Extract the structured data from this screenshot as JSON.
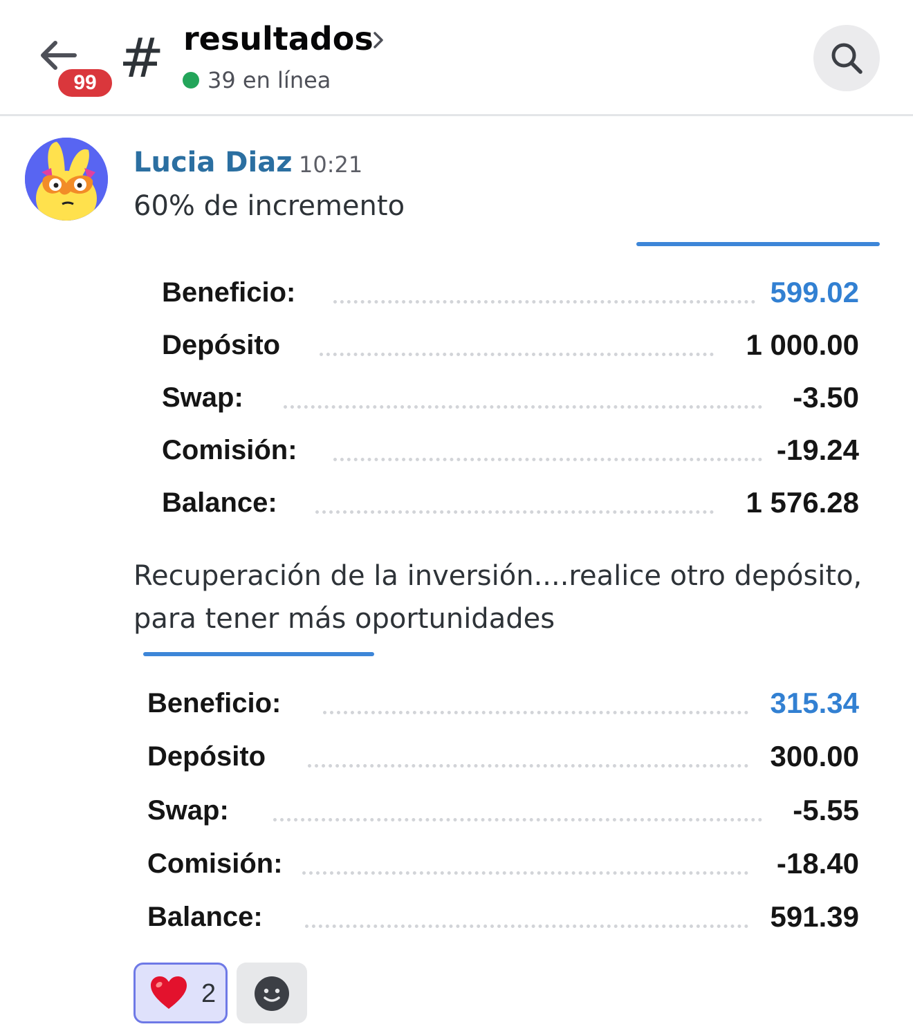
{
  "header": {
    "back_badge": "99",
    "channel_hash": "#",
    "channel_name": "resultados",
    "online_text": "39 en línea",
    "icons": {
      "back": "arrow-left-icon",
      "chevron": "chevron-right-icon",
      "search": "search-icon"
    }
  },
  "message": {
    "author": "Lucia Diaz",
    "time": "10:21",
    "text1": "60% de incremento",
    "text2": "Recuperación de la inversión....realice otro depósito, para tener más oportunidades",
    "author_color": "#2b6fa1"
  },
  "card1": {
    "rows": [
      {
        "label": "Beneficio:",
        "value": "599.02"
      },
      {
        "label": "Depósito",
        "value": "1 000.00"
      },
      {
        "label": "Swap:",
        "value": "-3.50"
      },
      {
        "label": "Comisión:",
        "value": "-19.24"
      },
      {
        "label": "Balance:",
        "value": "1 576.28"
      }
    ]
  },
  "card2": {
    "rows": [
      {
        "label": "Beneficio:",
        "value": "315.34"
      },
      {
        "label": "Depósito",
        "value": "300.00"
      },
      {
        "label": "Swap:",
        "value": "-5.55"
      },
      {
        "label": "Comisión:",
        "value": "-18.40"
      },
      {
        "label": "Balance:",
        "value": "591.39"
      }
    ]
  },
  "reactions": {
    "heart": {
      "emoji": "heart-emoji",
      "count": "2"
    },
    "add": "add-reaction-icon"
  },
  "colors": {
    "accent_blue": "#3280d2",
    "online_green": "#23a55a",
    "badge_red": "#da373c",
    "reaction_bg": "#dfe1fb",
    "reaction_border": "#6e79e6"
  }
}
